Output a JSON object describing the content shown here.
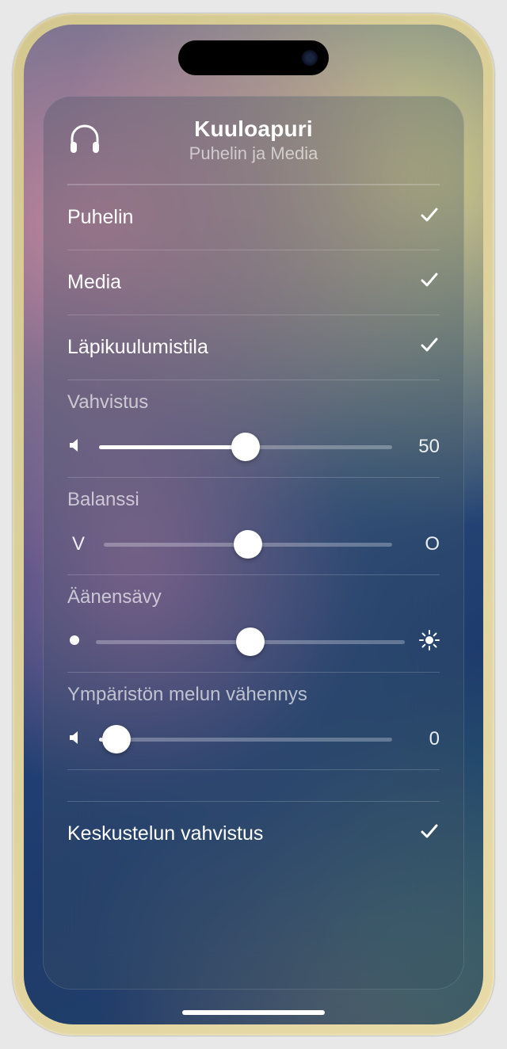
{
  "header": {
    "title": "Kuuloapuri",
    "subtitle": "Puhelin ja Media"
  },
  "options": [
    {
      "label": "Puhelin",
      "checked": true
    },
    {
      "label": "Media",
      "checked": true
    },
    {
      "label": "Läpikuulumistila",
      "checked": true
    }
  ],
  "sliders": {
    "gain": {
      "label": "Vahvistus",
      "value": "50",
      "percent": 50
    },
    "balance": {
      "label": "Balanssi",
      "left": "V",
      "right": "O",
      "percent": 50
    },
    "tone": {
      "label": "Äänensävy",
      "percent": 50
    },
    "noise": {
      "label": "Ympäristön melun vähennys",
      "value": "0",
      "percent": 6
    }
  },
  "footer": {
    "label": "Keskustelun vahvistus",
    "checked": true
  }
}
